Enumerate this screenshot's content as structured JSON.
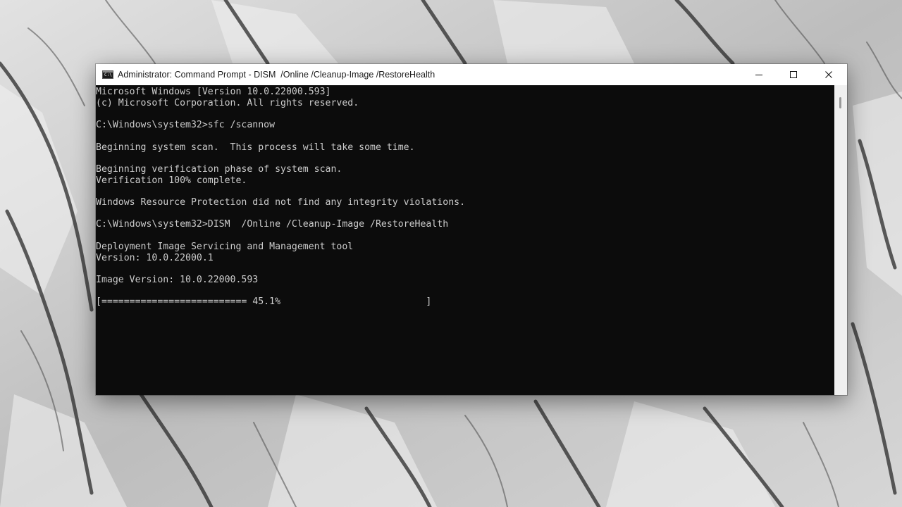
{
  "window": {
    "title": "Administrator: Command Prompt - DISM  /Online /Cleanup-Image /RestoreHealth",
    "icon": "cmd-app-icon",
    "controls": {
      "minimize_icon": "minimize-icon",
      "maximize_icon": "maximize-icon",
      "close_icon": "close-icon"
    }
  },
  "console": {
    "lines": [
      "Microsoft Windows [Version 10.0.22000.593]",
      "(c) Microsoft Corporation. All rights reserved.",
      "",
      "C:\\Windows\\system32>sfc /scannow",
      "",
      "Beginning system scan.  This process will take some time.",
      "",
      "Beginning verification phase of system scan.",
      "Verification 100% complete.",
      "",
      "Windows Resource Protection did not find any integrity violations.",
      "",
      "C:\\Windows\\system32>DISM  /Online /Cleanup-Image /RestoreHealth",
      "",
      "Deployment Image Servicing and Management tool",
      "Version: 10.0.22000.1",
      "",
      "Image Version: 10.0.22000.593",
      ""
    ],
    "progress_line": "[========================== 45.1%                          ]",
    "progress_percent": 45.1
  },
  "colors": {
    "console_bg": "#0c0c0c",
    "console_fg": "#cccccc",
    "titlebar_bg": "#ffffff"
  }
}
